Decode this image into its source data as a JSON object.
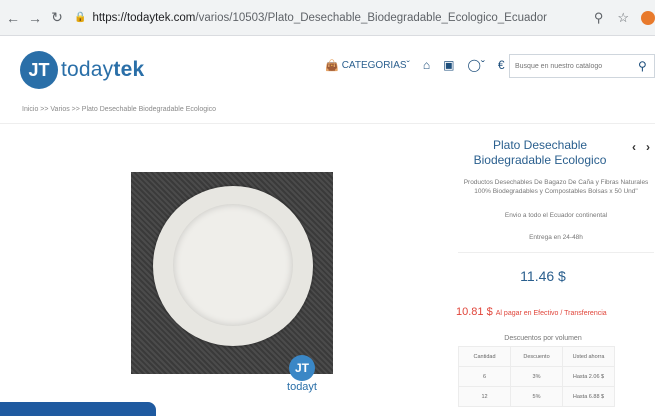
{
  "browser": {
    "url_host": "https://todaytek.com",
    "url_path": "/varios/10503/Plato_Desechable_Biodegradable_Ecologico_Ecuador"
  },
  "header": {
    "logo_mark": "JT",
    "logo_text_light": "today",
    "logo_text_bold": "tek",
    "categories_label": "CATEGORIAS",
    "search_placeholder": "Busque en nuestro catálogo"
  },
  "breadcrumb": "Inicio >> Varios >> Plato Desechable Biodegradable Ecologico",
  "product": {
    "title": "Plato Desechable Biodegradable Ecologico",
    "description": "Productos Desechables De Bagazo De Caña y Fibras Naturales 100% Biodegradables y Compostables Bolsas x 50 Und\"",
    "shipping": "Envio a todo el Ecuador continental",
    "delivery": "Entrega en 24-48h",
    "price": "11.46 $",
    "cash_price": "10.81 $",
    "cash_note": "Al pagar en Efectivo / Transferencia",
    "watermark_text": "todayt"
  },
  "discounts": {
    "title": "Descuentos por volumen",
    "headers": [
      "Cantidad",
      "Descuento",
      "Usted ahorra"
    ],
    "rows": [
      [
        "6",
        "3%",
        "Hasta 2.06 $"
      ],
      [
        "12",
        "5%",
        "Hasta 6.88 $"
      ]
    ]
  },
  "colors": {
    "brand": "#2a6fa8",
    "cash_price": "#e0453a"
  }
}
